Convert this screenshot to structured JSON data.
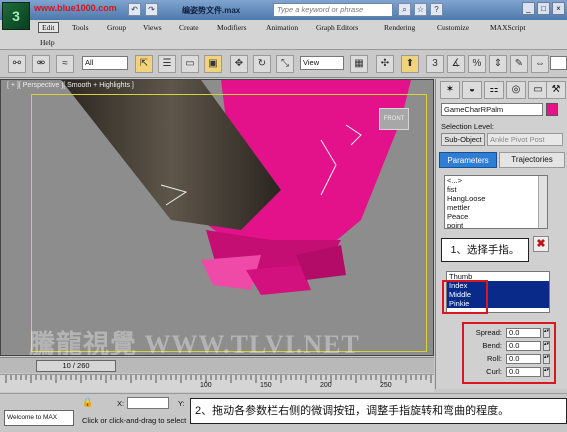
{
  "titlebar": {
    "watermark_url": "www.blue1000.com",
    "file_title": "编姿势文件.max",
    "search_placeholder": "Type a keyword or phrase",
    "logo_text": "3"
  },
  "menu": {
    "row1": [
      "Edit",
      "Tools",
      "Group",
      "Views",
      "Create",
      "Modifiers",
      "Animation",
      "Graph Editors",
      "Rendering",
      "Customize",
      "MAXScript"
    ],
    "row2": [
      "Help"
    ]
  },
  "toolbar": {
    "filter_value": "All",
    "refcoord_value": "View"
  },
  "viewport": {
    "label": "[ + ][ Perspective ][ Smooth + Highlights ]",
    "viewcube_label": "FRONT",
    "watermark": "騰龍視覺 WWW.TLVI.NET"
  },
  "command_panel": {
    "object_name": "GameCharRPalm",
    "object_color": "#e8138a",
    "selection_level_label": "Selection Level:",
    "subobject_label": "Sub-Object",
    "subobject_value": "Ankle Pivot Post",
    "tab_parameters": "Parameters",
    "tab_trajectories": "Trajectories",
    "poses": [
      "<...>",
      "fist",
      "HangLoose",
      "mettler",
      "Peace",
      "point"
    ],
    "fingers": [
      {
        "label": "Thumb",
        "selected": false
      },
      {
        "label": "Index",
        "selected": true
      },
      {
        "label": "Middle",
        "selected": true
      },
      {
        "label": "Pinkie",
        "selected": true
      }
    ],
    "params": [
      {
        "label": "Spread:",
        "value": "0.0"
      },
      {
        "label": "Bend:",
        "value": "0.0"
      },
      {
        "label": "Roll:",
        "value": "0.0"
      },
      {
        "label": "Curl:",
        "value": "0.0"
      }
    ]
  },
  "callouts": {
    "step1": "1、选择手指。",
    "step2": "2、拖动各参数栏右侧的微调按钮，调整手指旋转和弯曲的程度。"
  },
  "timeline": {
    "position": "10 / 260",
    "tick_labels": [
      "100",
      "150",
      "200",
      "250"
    ]
  },
  "status": {
    "maxscript_text": "Welcome to MAX",
    "x_label": "X:",
    "y_label": "Y:",
    "prompt": "Click or click-and-drag to select"
  }
}
